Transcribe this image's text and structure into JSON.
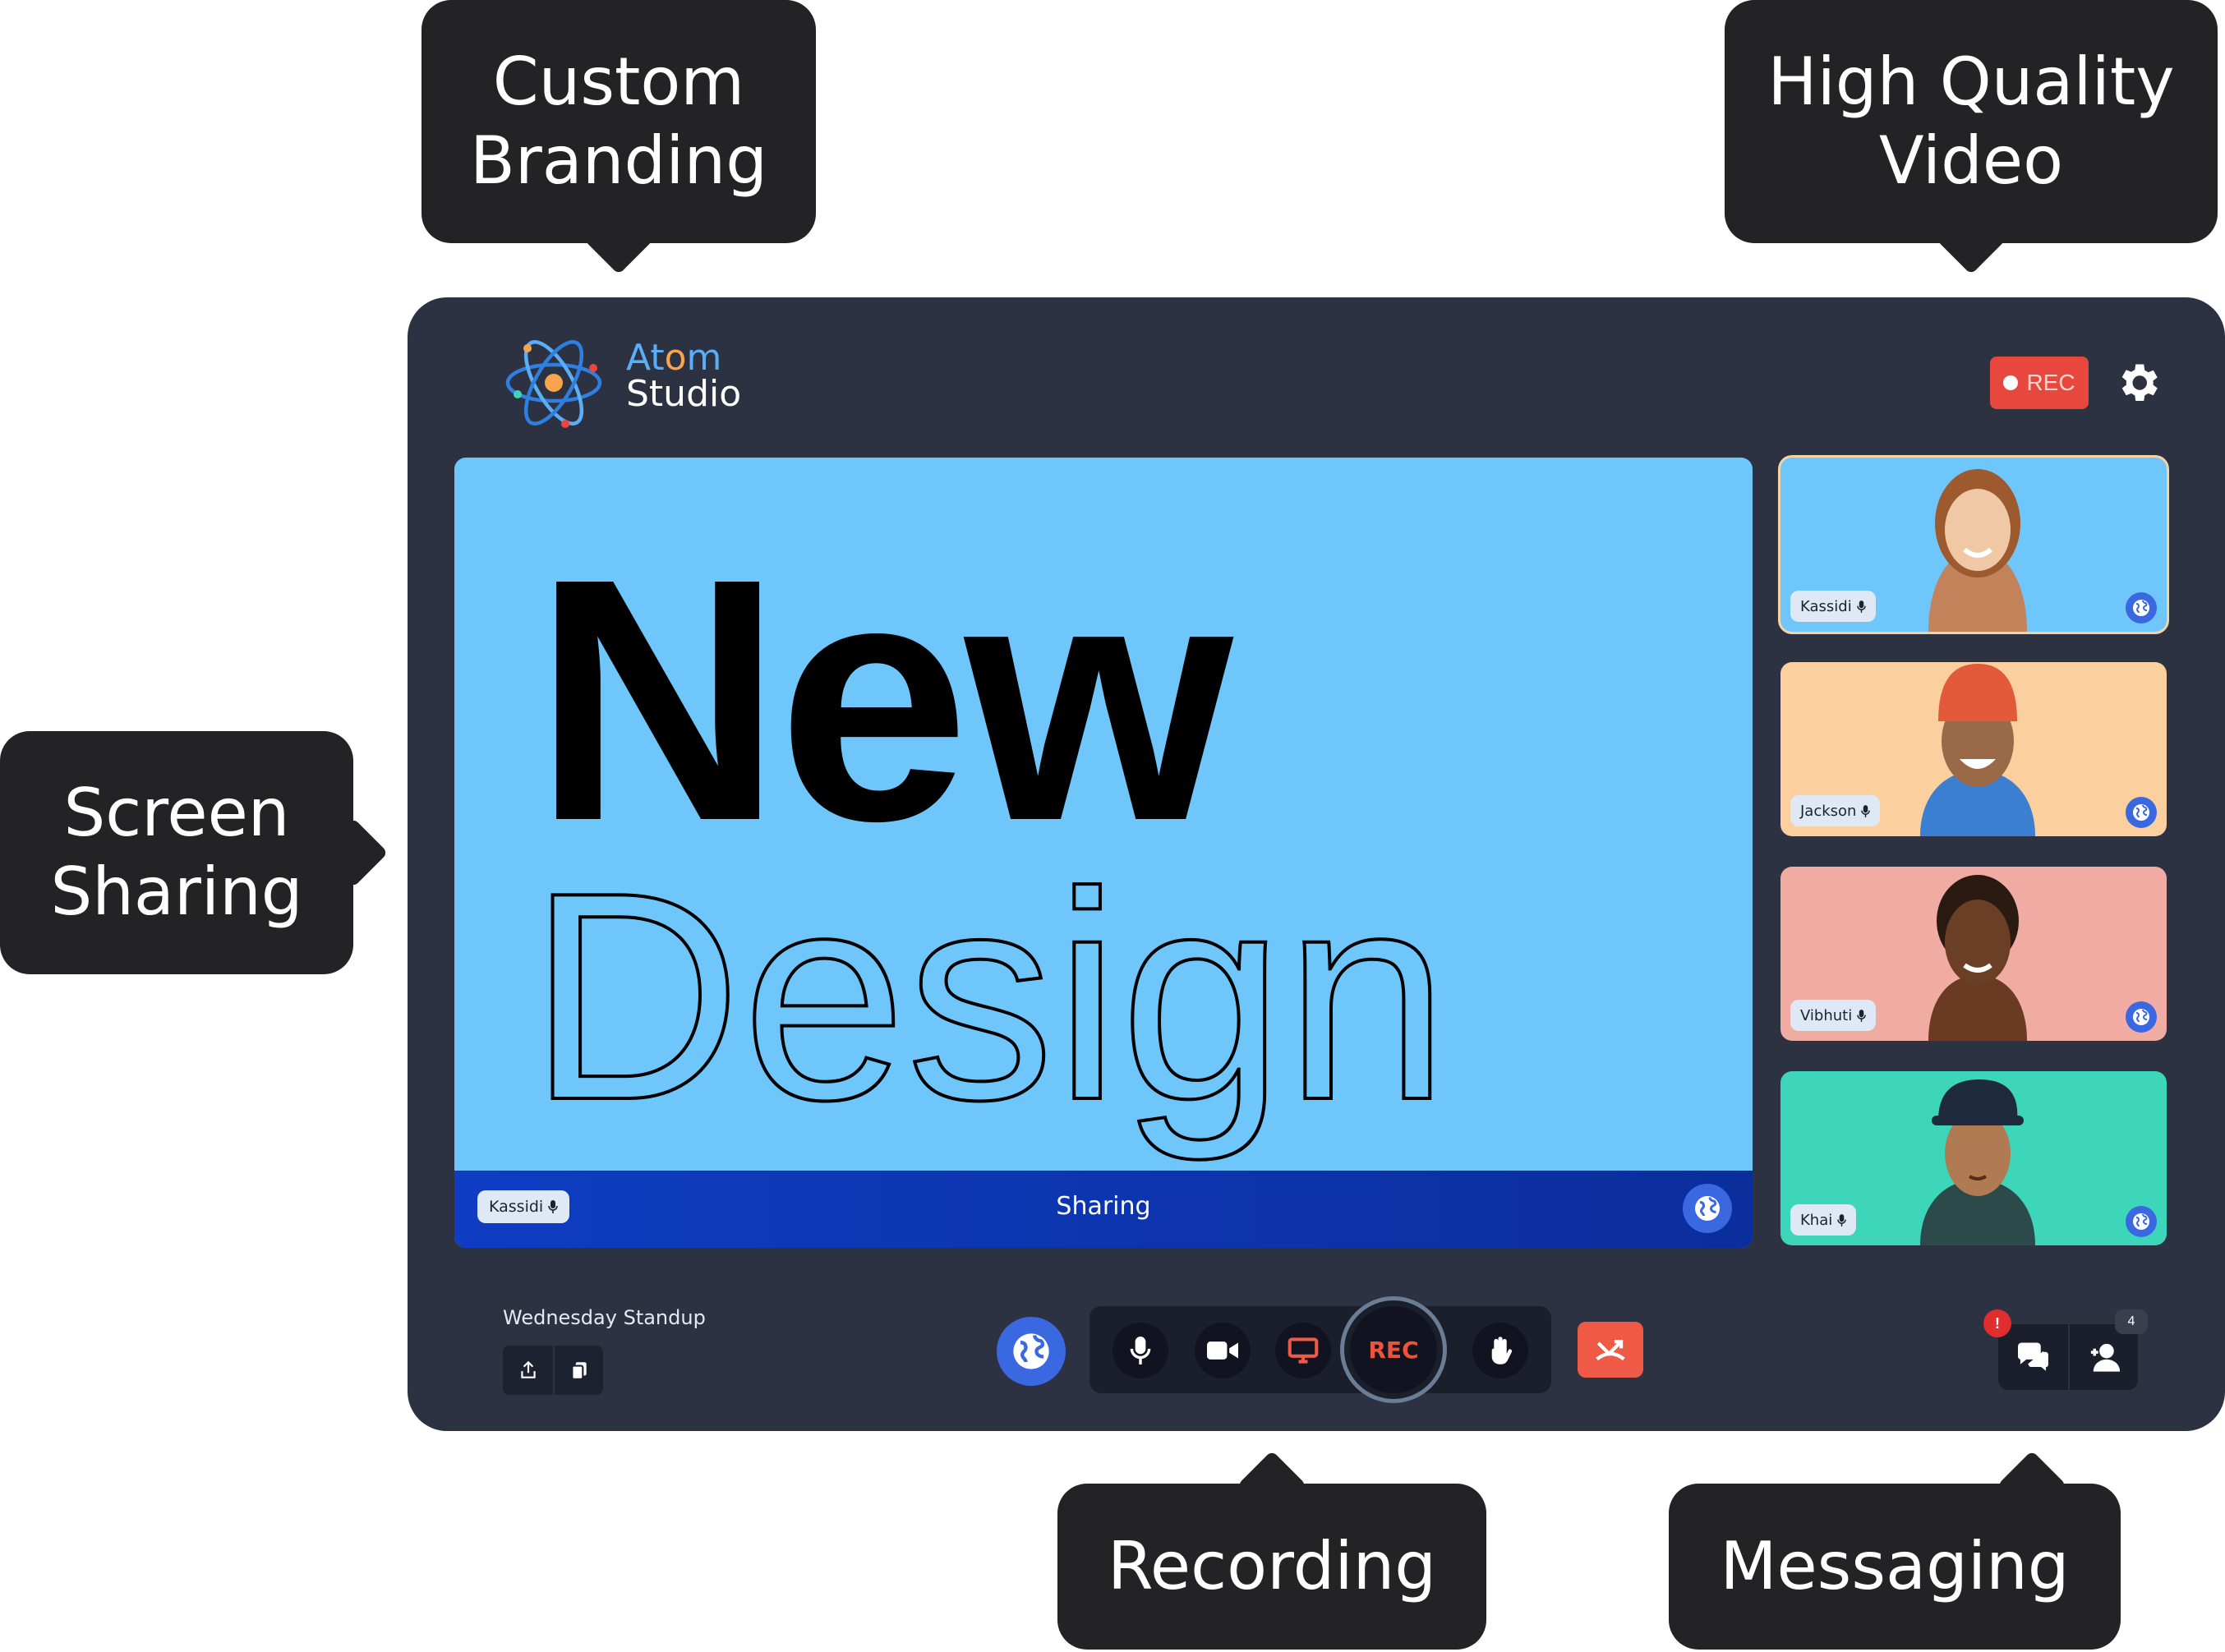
{
  "callouts": {
    "custom_branding": "Custom\nBranding",
    "high_quality_video": "High Quality\nVideo",
    "screen_sharing": "Screen\nSharing",
    "recording": "Recording",
    "messaging": "Messaging"
  },
  "header": {
    "brand_line1_a": "At",
    "brand_line1_o": "o",
    "brand_line1_b": "m",
    "brand_line2": "Studio",
    "rec_label": "REC"
  },
  "stage": {
    "slide_line1": "New",
    "slide_line2": "Design",
    "presenter": "Kassidi",
    "status": "Sharing"
  },
  "participants": [
    {
      "name": "Kassidi",
      "bg": "#6fc6fb"
    },
    {
      "name": "Jackson",
      "bg": "#fbd09e"
    },
    {
      "name": "Vibhuti",
      "bg": "#f0aba2"
    },
    {
      "name": "Khai",
      "bg": "#3dd6bb"
    }
  ],
  "toolbar": {
    "meeting_title": "Wednesday Standup",
    "rec_label": "REC",
    "alert_badge": "!",
    "participants_count": "4"
  },
  "icons": {
    "share": "share-icon",
    "copy": "copy-icon",
    "globe": "globe-icon",
    "mic": "microphone-icon",
    "camera": "camera-icon",
    "screen": "screen-share-icon",
    "hand": "raise-hand-icon",
    "end": "end-call-icon",
    "chat": "chat-icon",
    "people": "participants-icon",
    "settings": "gear-icon"
  },
  "colors": {
    "accent_blue": "#3a68e0",
    "record_red": "#e8473e",
    "end_call": "#ee5a45",
    "window_bg": "#2c3242"
  }
}
